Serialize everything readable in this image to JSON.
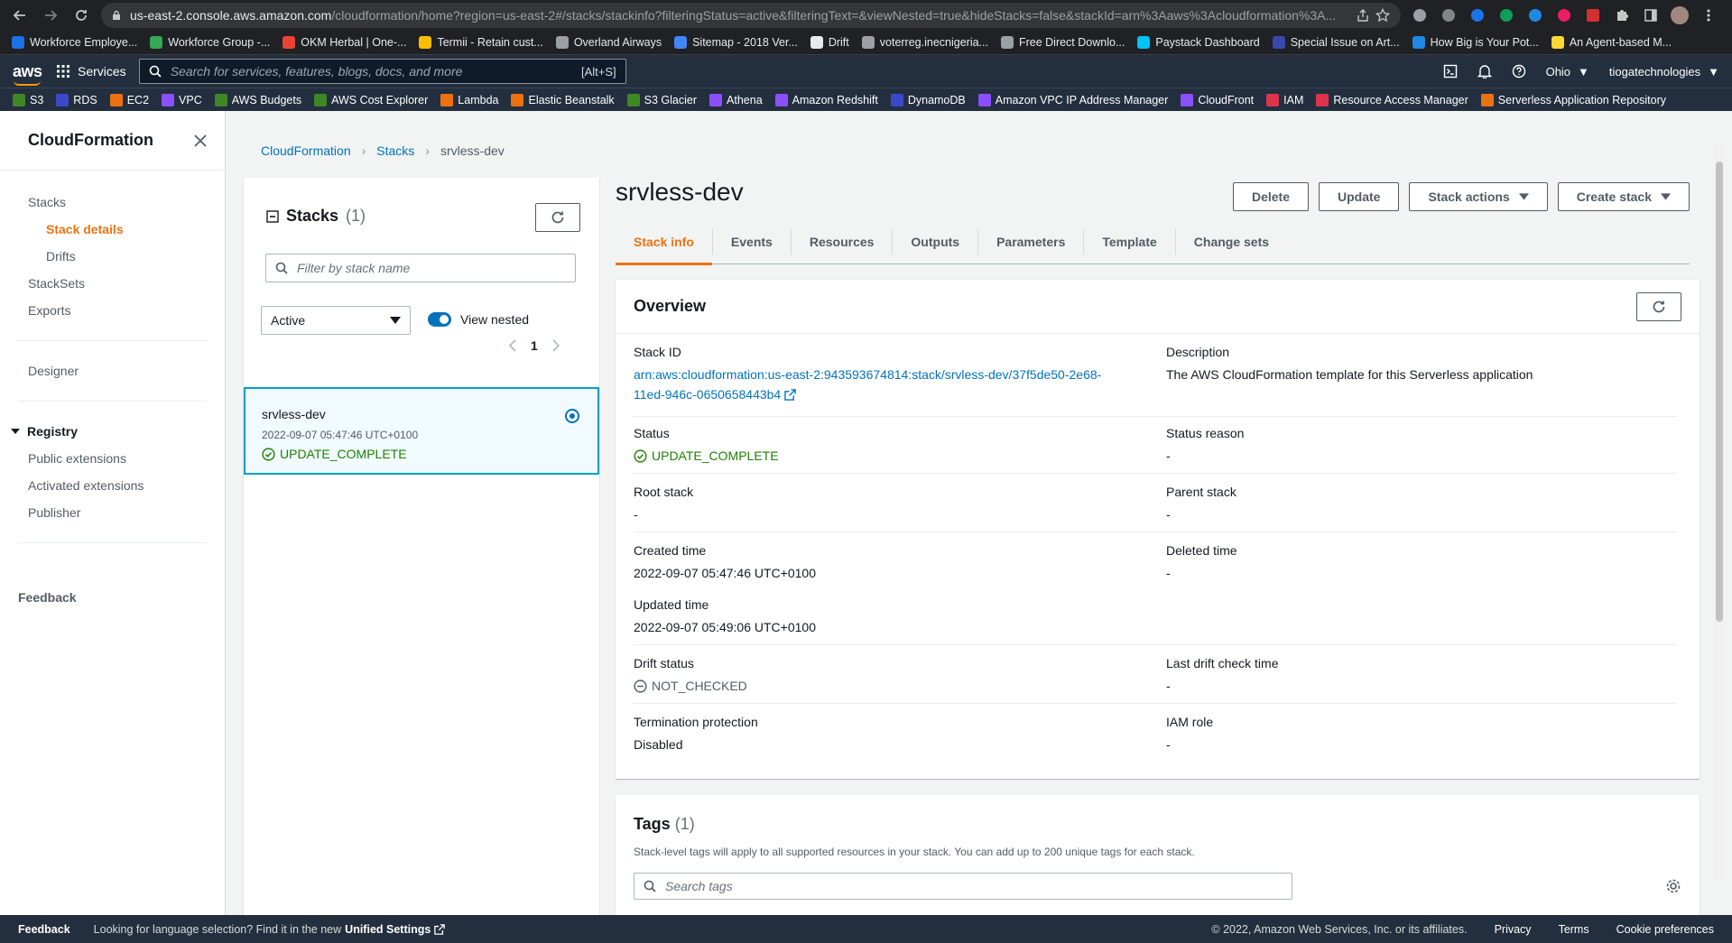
{
  "browser": {
    "url_host": "us-east-2.console.aws.amazon.com",
    "url_path": "/cloudformation/home?region=us-east-2#/stacks/stackinfo?filteringStatus=active&filteringText=&viewNested=true&hideStacks=false&stackId=arn%3Aaws%3Acloudformation%3A...",
    "bookmarks": [
      {
        "label": "Workforce Employe...",
        "color": "#1a73e8"
      },
      {
        "label": "Workforce Group -...",
        "color": "#34a853"
      },
      {
        "label": "OKM Herbal | One-...",
        "color": "#ea4335"
      },
      {
        "label": "Termii - Retain cust...",
        "color": "#fbbc04"
      },
      {
        "label": "Overland Airways",
        "color": "#9aa0a6"
      },
      {
        "label": "Sitemap - 2018 Ver...",
        "color": "#4285f4"
      },
      {
        "label": "Drift",
        "color": "#e8eaed"
      },
      {
        "label": "voterreg.inecnigeria...",
        "color": "#9aa0a6"
      },
      {
        "label": "Free Direct Downlo...",
        "color": "#9aa0a6"
      },
      {
        "label": "Paystack Dashboard",
        "color": "#00c3f7"
      },
      {
        "label": "Special Issue on Art...",
        "color": "#3949ab"
      },
      {
        "label": "How Big is Your Pot...",
        "color": "#1e88e5"
      },
      {
        "label": "An Agent-based M...",
        "color": "#fdd835"
      }
    ]
  },
  "aws_nav": {
    "logo": "aws",
    "services": "Services",
    "search_placeholder": "Search for services, features, blogs, docs, and more",
    "search_hint": "[Alt+S]",
    "region": "Ohio",
    "account": "tiogatechnologies",
    "favorites": [
      {
        "label": "S3",
        "color": "#3f8624"
      },
      {
        "label": "RDS",
        "color": "#3b48cc"
      },
      {
        "label": "EC2",
        "color": "#ec7211"
      },
      {
        "label": "VPC",
        "color": "#8c4fff"
      },
      {
        "label": "AWS Budgets",
        "color": "#3f8624"
      },
      {
        "label": "AWS Cost Explorer",
        "color": "#3f8624"
      },
      {
        "label": "Lambda",
        "color": "#ec7211"
      },
      {
        "label": "Elastic Beanstalk",
        "color": "#ec7211"
      },
      {
        "label": "S3 Glacier",
        "color": "#3f8624"
      },
      {
        "label": "Athena",
        "color": "#8c4fff"
      },
      {
        "label": "Amazon Redshift",
        "color": "#8c4fff"
      },
      {
        "label": "DynamoDB",
        "color": "#3b48cc"
      },
      {
        "label": "Amazon VPC IP Address Manager",
        "color": "#8c4fff"
      },
      {
        "label": "CloudFront",
        "color": "#8c4fff"
      },
      {
        "label": "IAM",
        "color": "#dd344c"
      },
      {
        "label": "Resource Access Manager",
        "color": "#dd344c"
      },
      {
        "label": "Serverless Application Repository",
        "color": "#ec7211"
      }
    ]
  },
  "sidenav": {
    "title": "CloudFormation",
    "stacks": "Stacks",
    "stack_details": "Stack details",
    "drifts": "Drifts",
    "stacksets": "StackSets",
    "exports": "Exports",
    "designer": "Designer",
    "registry": "Registry",
    "public_extensions": "Public extensions",
    "activated_extensions": "Activated extensions",
    "publisher": "Publisher",
    "feedback": "Feedback"
  },
  "breadcrumb": [
    "CloudFormation",
    "Stacks",
    "srvless-dev"
  ],
  "stacks_panel": {
    "title": "Stacks",
    "count": "(1)",
    "filter_placeholder": "Filter by stack name",
    "status_filter": "Active",
    "view_nested": "View nested",
    "page": "1",
    "stack": {
      "name": "srvless-dev",
      "date": "2022-09-07 05:47:46 UTC+0100",
      "status": "UPDATE_COMPLETE"
    }
  },
  "detail": {
    "title": "srvless-dev",
    "buttons": {
      "delete": "Delete",
      "update": "Update",
      "stack_actions": "Stack actions",
      "create_stack": "Create stack"
    },
    "tabs": [
      "Stack info",
      "Events",
      "Resources",
      "Outputs",
      "Parameters",
      "Template",
      "Change sets"
    ],
    "overview": {
      "title": "Overview",
      "stack_id_label": "Stack ID",
      "stack_id_line1": "arn:aws:cloudformation:us-east-2:943593674814:stack/srvless-dev/37f5de50-2e68-",
      "stack_id_line2": "11ed-946c-0650658443b4",
      "description_label": "Description",
      "description": "The AWS CloudFormation template for this Serverless application",
      "status_label": "Status",
      "status": "UPDATE_COMPLETE",
      "status_reason_label": "Status reason",
      "status_reason": "-",
      "root_stack_label": "Root stack",
      "root_stack": "-",
      "parent_stack_label": "Parent stack",
      "parent_stack": "-",
      "created_label": "Created time",
      "created": "2022-09-07 05:47:46 UTC+0100",
      "deleted_label": "Deleted time",
      "deleted": "-",
      "updated_label": "Updated time",
      "updated": "2022-09-07 05:49:06 UTC+0100",
      "drift_label": "Drift status",
      "drift": "NOT_CHECKED",
      "last_drift_label": "Last drift check time",
      "last_drift": "-",
      "termination_label": "Termination protection",
      "termination": "Disabled",
      "iam_label": "IAM role",
      "iam": "-"
    },
    "tags": {
      "title": "Tags",
      "count": "(1)",
      "description": "Stack-level tags will apply to all supported resources in your stack. You can add up to 200 unique tags for each stack.",
      "search_placeholder": "Search tags"
    }
  },
  "footer": {
    "feedback": "Feedback",
    "lang_text": "Looking for language selection? Find it in the new",
    "unified_settings": "Unified Settings",
    "copyright": "© 2022, Amazon Web Services, Inc. or its affiliates.",
    "privacy": "Privacy",
    "terms": "Terms",
    "cookies": "Cookie preferences"
  }
}
